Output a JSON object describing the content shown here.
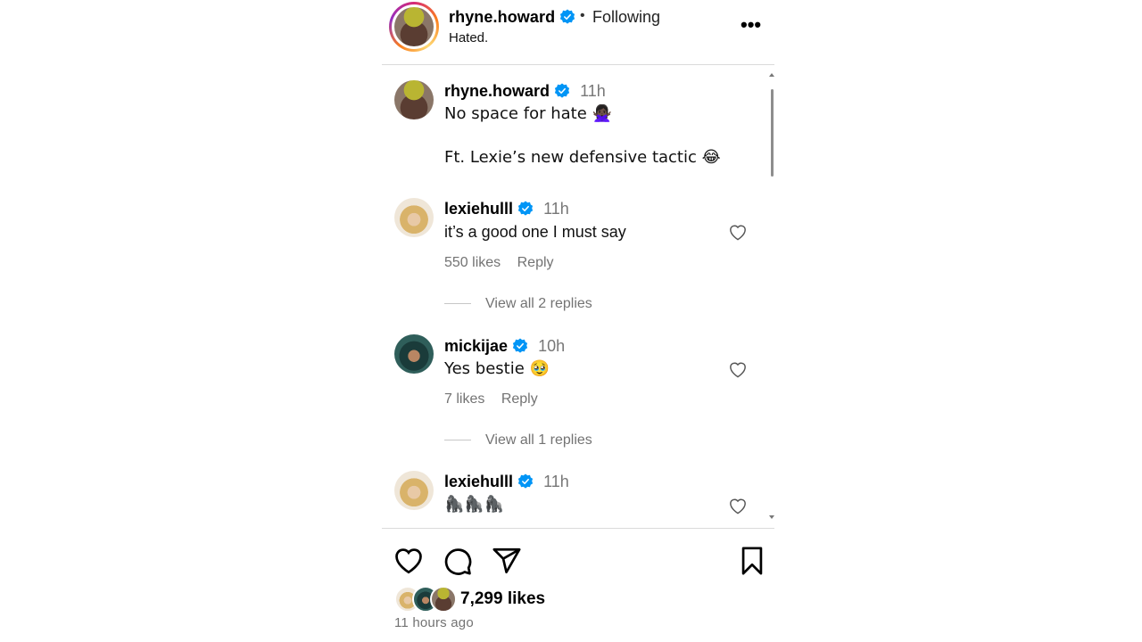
{
  "header": {
    "username": "rhyne.howard",
    "separator": "•",
    "follow_status": "Following",
    "audio_or_caption": "Hated.",
    "more_label": "•••"
  },
  "caption": {
    "username": "rhyne.howard",
    "time": "11h",
    "line1": "No space for hate 🙅🏿‍♀️",
    "line2": "Ft. Lexie’s new defensive tactic 😂"
  },
  "comments": [
    {
      "username": "lexiehulll",
      "time": "11h",
      "text": "it’s a good one I must say",
      "likes": "550 likes",
      "reply": "Reply",
      "view_replies": "View all 2 replies"
    },
    {
      "username": "mickijae",
      "time": "10h",
      "text": "Yes bestie 🥹",
      "likes": "7 likes",
      "reply": "Reply",
      "view_replies": "View all 1 replies"
    },
    {
      "username": "lexiehulll",
      "time": "11h",
      "text": "🦍🦍🦍"
    }
  ],
  "footer": {
    "likes": "7,299 likes",
    "time_ago": "11 hours ago"
  },
  "colors": {
    "verified_blue": "#0095f6",
    "muted_text": "#737373",
    "divider": "#dbdbdb"
  },
  "icons": [
    "heart-icon",
    "comment-icon",
    "share-icon",
    "bookmark-icon",
    "verified-badge-icon",
    "more-options-icon"
  ]
}
